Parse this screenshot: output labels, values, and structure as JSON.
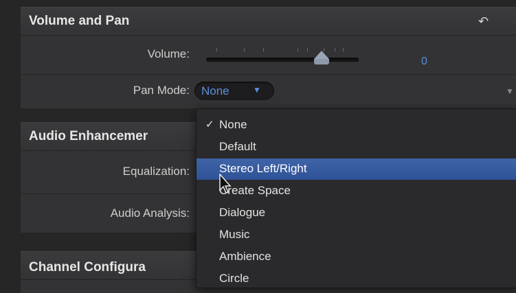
{
  "volume_pan": {
    "title": "Volume and Pan",
    "reset_icon": "reset-icon",
    "volume_label": "Volume:",
    "volume_value": "0",
    "pan_mode_label": "Pan Mode:",
    "pan_mode_value": "None",
    "dropdown_icon": "chevron-down-icon"
  },
  "audio_enhancements": {
    "title": "Audio Enhancemer",
    "equalization_label": "Equalization:",
    "audio_analysis_label": "Audio Analysis:"
  },
  "channel_configuration": {
    "title": "Channel Configura"
  },
  "pan_menu": {
    "items": [
      {
        "label": "None",
        "checked": "✓"
      },
      {
        "label": "Default"
      },
      {
        "label": "Stereo Left/Right"
      },
      {
        "label": "Create Space"
      },
      {
        "label": "Dialogue"
      },
      {
        "label": "Music"
      },
      {
        "label": "Ambience"
      },
      {
        "label": "Circle"
      }
    ],
    "highlighted_item": "Stereo Left/Right"
  },
  "colors": {
    "accent": "#5c8ede",
    "highlight": "#3a5fa3",
    "panel": "#333335"
  }
}
